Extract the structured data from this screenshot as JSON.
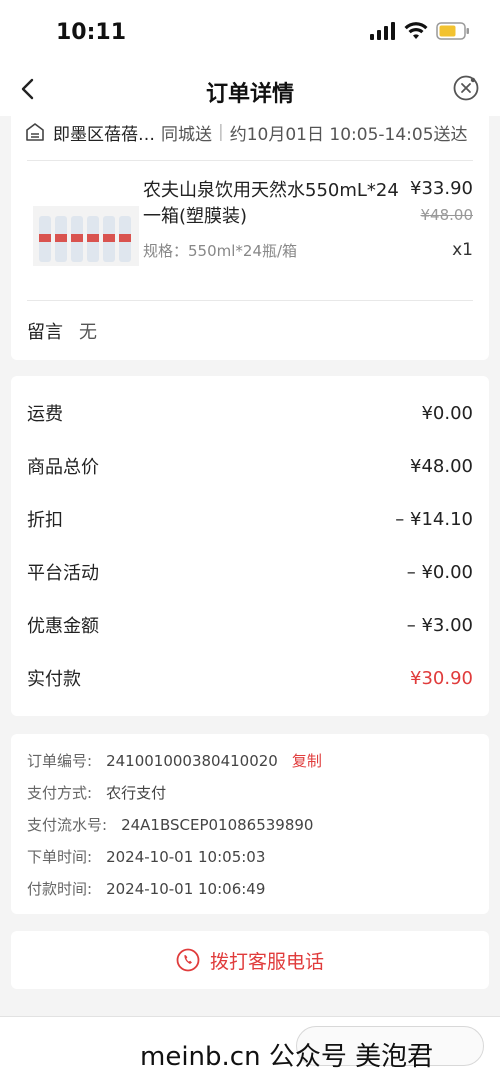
{
  "status": {
    "time": "10:11"
  },
  "nav": {
    "title": "订单详情"
  },
  "delivery": {
    "address": "即墨区蓓蓓…",
    "mode": "同城送",
    "time": "约10月01日 10:05-14:05送达"
  },
  "product": {
    "name": "农夫山泉饮用天然水550mL*24一箱(塑膜装)",
    "spec": "规格：550ml*24瓶/箱",
    "price": "¥33.90",
    "original_price": "¥48.00",
    "quantity": "x1"
  },
  "note": {
    "label": "留言",
    "value": "无"
  },
  "fees": [
    {
      "label": "运费",
      "value": "¥0.00"
    },
    {
      "label": "商品总价",
      "value": "¥48.00"
    },
    {
      "label": "折扣",
      "value": "– ¥14.10"
    },
    {
      "label": "平台活动",
      "value": "– ¥0.00"
    },
    {
      "label": "优惠金额",
      "value": "– ¥3.00"
    },
    {
      "label": "实付款",
      "value": "¥30.90"
    }
  ],
  "info": {
    "order_no_label": "订单编号:",
    "order_no": "241001000380410020",
    "copy_label": "复制",
    "pay_method_label": "支付方式:",
    "pay_method": "农行支付",
    "pay_serial_label": "支付流水号:",
    "pay_serial": "24A1BSCEP01086539890",
    "order_time_label": "下单时间:",
    "order_time": "2024-10-01 10:05:03",
    "pay_time_label": "付款时间:",
    "pay_time": "2024-10-01 10:06:49"
  },
  "service": {
    "label": "拨打客服电话"
  },
  "watermark": {
    "text": "meinb.cn 公众号 美泡君"
  },
  "colors": {
    "accent_red": "#e03c3c"
  }
}
